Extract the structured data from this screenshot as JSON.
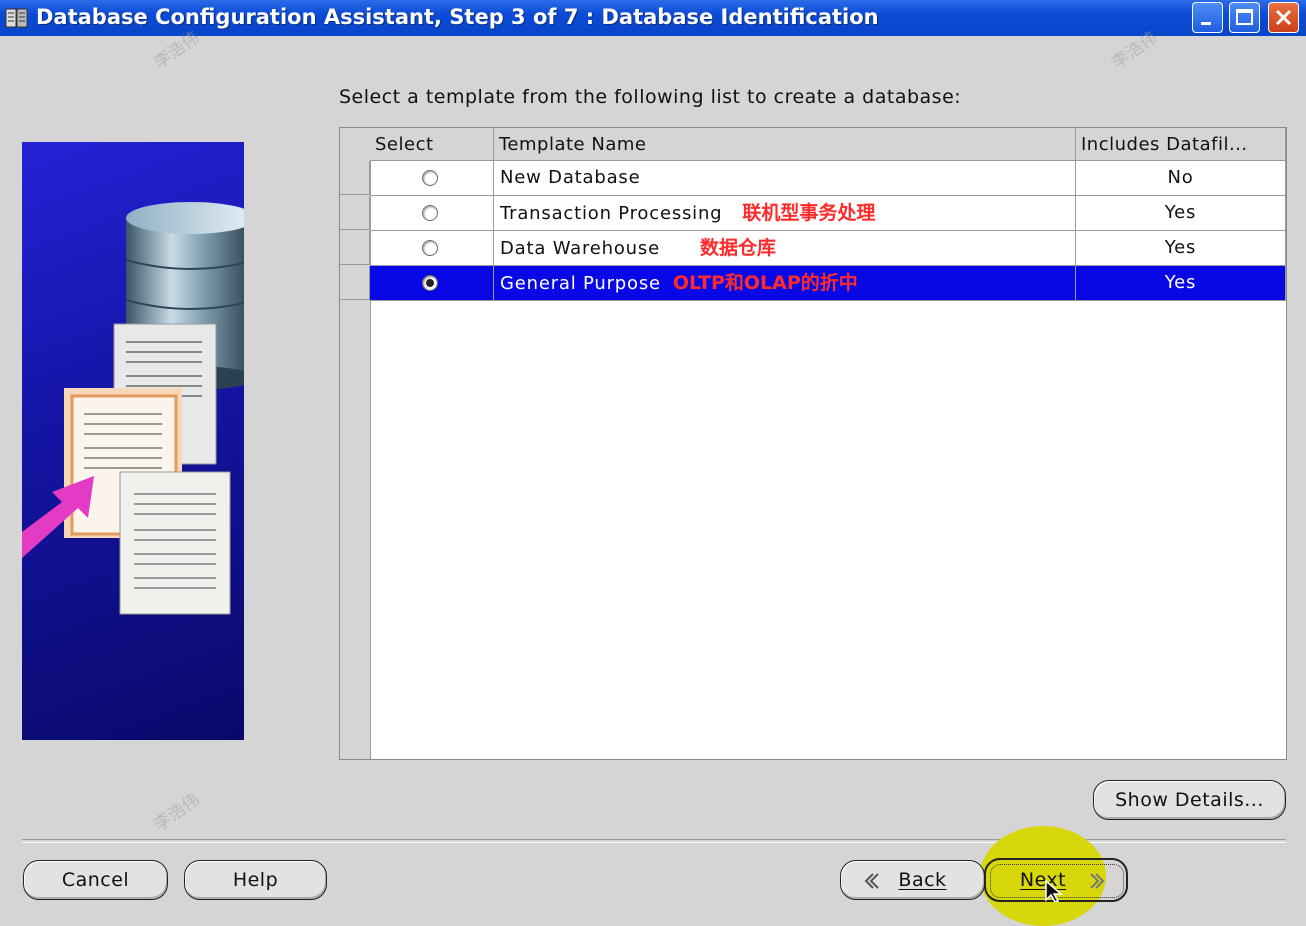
{
  "window": {
    "title": "Database Configuration Assistant, Step 3 of 7 : Database Identification",
    "icon": "database-app-icon",
    "controls": [
      "minimize-icon",
      "maximize-icon",
      "close-icon"
    ]
  },
  "main": {
    "instruction": "Select a template from the following list to create a database:",
    "table": {
      "headers": [
        "Select",
        "Template Name",
        "Includes Datafil..."
      ],
      "rows": [
        {
          "selected": false,
          "name": "New Database",
          "note": "",
          "includes": "No"
        },
        {
          "selected": false,
          "name": "Transaction Processing",
          "note": "联机型事务处理",
          "includes": "Yes"
        },
        {
          "selected": false,
          "name": "Data Warehouse",
          "note": "数据仓库",
          "includes": "Yes"
        },
        {
          "selected": true,
          "name": "General Purpose",
          "note": "OLTP和OLAP的折中",
          "includes": "Yes"
        }
      ]
    },
    "show_details_label": "Show Details..."
  },
  "footer": {
    "cancel_label": "Cancel",
    "help_label": "Help",
    "back_label": "Back",
    "next_label": "Next"
  },
  "watermark": "李浩伟",
  "colors": {
    "selection": "#0808e6",
    "annotation": "#ff2b2b",
    "titlebar": "#0a4ad6",
    "cursor_highlight": "#d7d700"
  }
}
